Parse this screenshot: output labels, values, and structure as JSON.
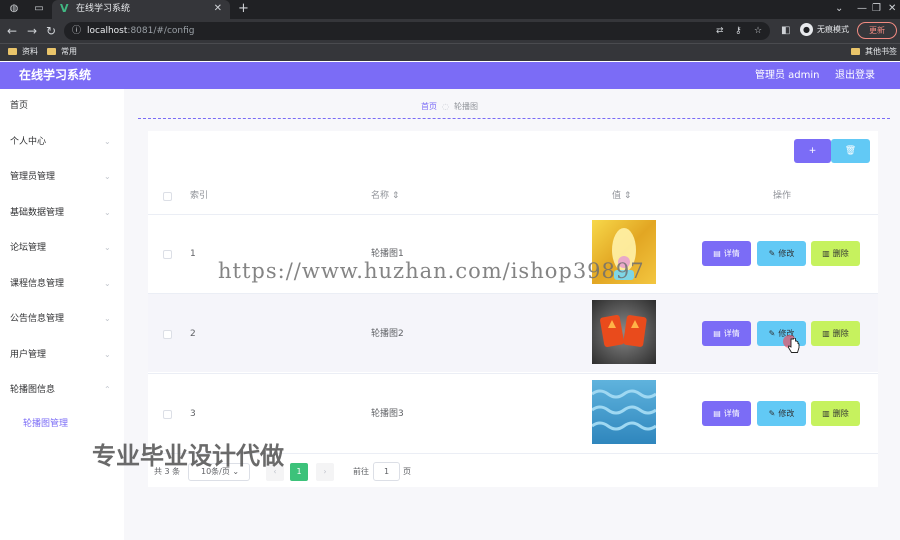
{
  "browser": {
    "tab_title": "在线学习系统",
    "url_host": "localhost",
    "url_rest": ":8081/#/config",
    "incognito_label": "无痕模式",
    "update_label": "更新",
    "bookmarks": [
      "资料",
      "常用"
    ],
    "other_bookmarks": "其他书签"
  },
  "header": {
    "app_title": "在线学习系统",
    "admin_label": "管理员 admin",
    "logout_label": "退出登录"
  },
  "sidebar": {
    "items": [
      {
        "label": "首页"
      },
      {
        "label": "个人中心"
      },
      {
        "label": "管理员管理"
      },
      {
        "label": "基础数据管理"
      },
      {
        "label": "论坛管理"
      },
      {
        "label": "课程信息管理"
      },
      {
        "label": "公告信息管理"
      },
      {
        "label": "用户管理"
      },
      {
        "label": "轮播图信息"
      }
    ],
    "sub_item": "轮播图管理"
  },
  "breadcrumb": {
    "home": "首页",
    "current": "轮播图"
  },
  "table": {
    "headers": {
      "index": "索引",
      "name": "名称",
      "value": "值",
      "ops": "操作"
    },
    "rows": [
      {
        "index": "1",
        "name": "轮播图1",
        "image": "carousel-image-golden-character"
      },
      {
        "index": "2",
        "name": "轮播图2",
        "image": "carousel-image-fire-cards"
      },
      {
        "index": "3",
        "name": "轮播图3",
        "image": "carousel-image-blue-water"
      }
    ],
    "ops": {
      "detail": "详情",
      "edit": "修改",
      "delete": "删除"
    }
  },
  "pagination": {
    "total": "共 3 条",
    "page_size": "10条/页",
    "current_page": "1",
    "goto_label": "前往",
    "goto_value": "1",
    "page_suffix": "页"
  },
  "overlay": {
    "watermark_url": "https://www.huzhan.com/ishop39897",
    "watermark_cn": "专业毕业设计代做"
  },
  "colors": {
    "accent": "#7b6cf6",
    "edit": "#62c9f5",
    "delete": "#c6f25e",
    "pager_active": "#3cc27a"
  }
}
